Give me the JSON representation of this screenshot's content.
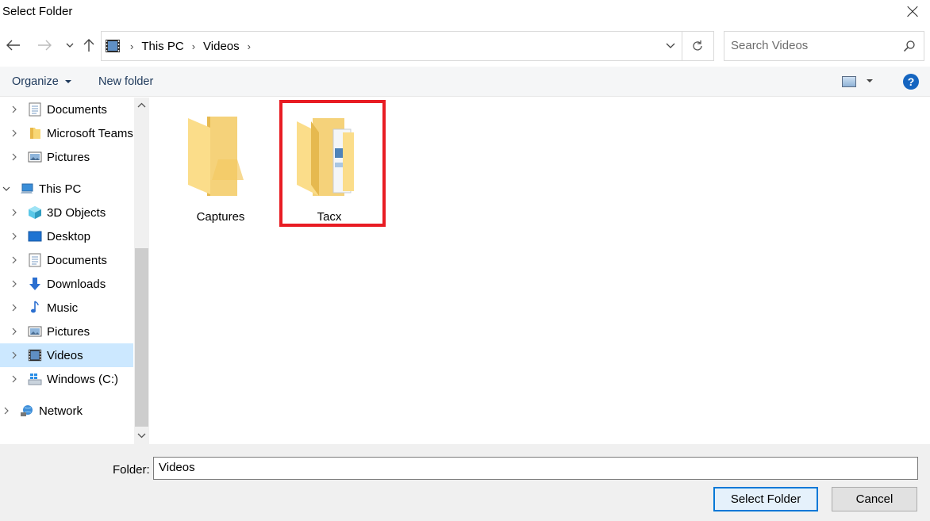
{
  "window": {
    "title": "Select Folder"
  },
  "nav": {
    "breadcrumbs": [
      "This PC",
      "Videos"
    ],
    "search_placeholder": "Search Videos"
  },
  "toolbar": {
    "organize": "Organize",
    "new_folder": "New folder",
    "help": "?"
  },
  "sidebar": {
    "items": [
      {
        "label": "Documents",
        "icon": "documents-icon"
      },
      {
        "label": "Microsoft Teams",
        "icon": "folder-icon"
      },
      {
        "label": "Pictures",
        "icon": "pictures-icon"
      },
      {
        "label": "This PC",
        "icon": "computer-icon"
      },
      {
        "label": "3D Objects",
        "icon": "cube-icon"
      },
      {
        "label": "Desktop",
        "icon": "desktop-icon"
      },
      {
        "label": "Documents",
        "icon": "documents-icon"
      },
      {
        "label": "Downloads",
        "icon": "download-icon"
      },
      {
        "label": "Music",
        "icon": "music-icon"
      },
      {
        "label": "Pictures",
        "icon": "pictures-icon"
      },
      {
        "label": "Videos",
        "icon": "videos-icon"
      },
      {
        "label": "Windows (C:)",
        "icon": "drive-icon"
      },
      {
        "label": "Network",
        "icon": "network-icon"
      }
    ]
  },
  "content": {
    "folders": [
      {
        "label": "Captures"
      },
      {
        "label": "Tacx"
      }
    ]
  },
  "footer": {
    "folder_label": "Folder:",
    "folder_value": "Videos",
    "select_button": "Select Folder",
    "cancel_button": "Cancel"
  }
}
